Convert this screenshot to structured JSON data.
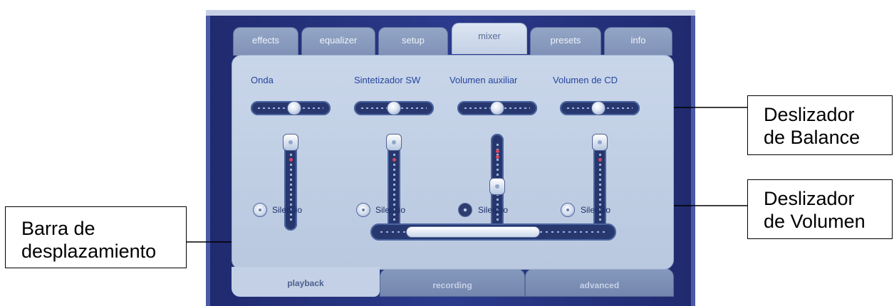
{
  "top_tabs": [
    {
      "label": "effects",
      "active": false
    },
    {
      "label": "equalizer",
      "active": false
    },
    {
      "label": "setup",
      "active": false
    },
    {
      "label": "mixer",
      "active": true
    },
    {
      "label": "presets",
      "active": false
    },
    {
      "label": "info",
      "active": false
    }
  ],
  "channels": [
    {
      "name": "Onda",
      "balance": 0.55,
      "volume": 1.0,
      "mute_label": "Silencio",
      "muted": false
    },
    {
      "name": "Sintetizador SW",
      "balance": 0.5,
      "volume": 1.0,
      "mute_label": "Silencio",
      "muted": false
    },
    {
      "name": "Volumen auxiliar",
      "balance": 0.5,
      "volume": 0.45,
      "mute_label": "Silencio",
      "muted": true
    },
    {
      "name": "Volumen de CD",
      "balance": 0.48,
      "volume": 1.0,
      "mute_label": "Silencio",
      "muted": false
    }
  ],
  "bottom_tabs": [
    {
      "label": "playback",
      "active": true
    },
    {
      "label": "recording",
      "active": false
    },
    {
      "label": "advanced",
      "active": false
    }
  ],
  "annotations": {
    "balance": [
      "Deslizador",
      "de Balance"
    ],
    "volume": [
      "Deslizador",
      "de Volumen"
    ],
    "scroll": [
      "Barra de",
      "desplazamiento"
    ]
  },
  "colors": {
    "frame": "#2b3a8c",
    "panel": "#c9d6ea",
    "label_text": "#26459c",
    "slider_track": "#28386f"
  }
}
